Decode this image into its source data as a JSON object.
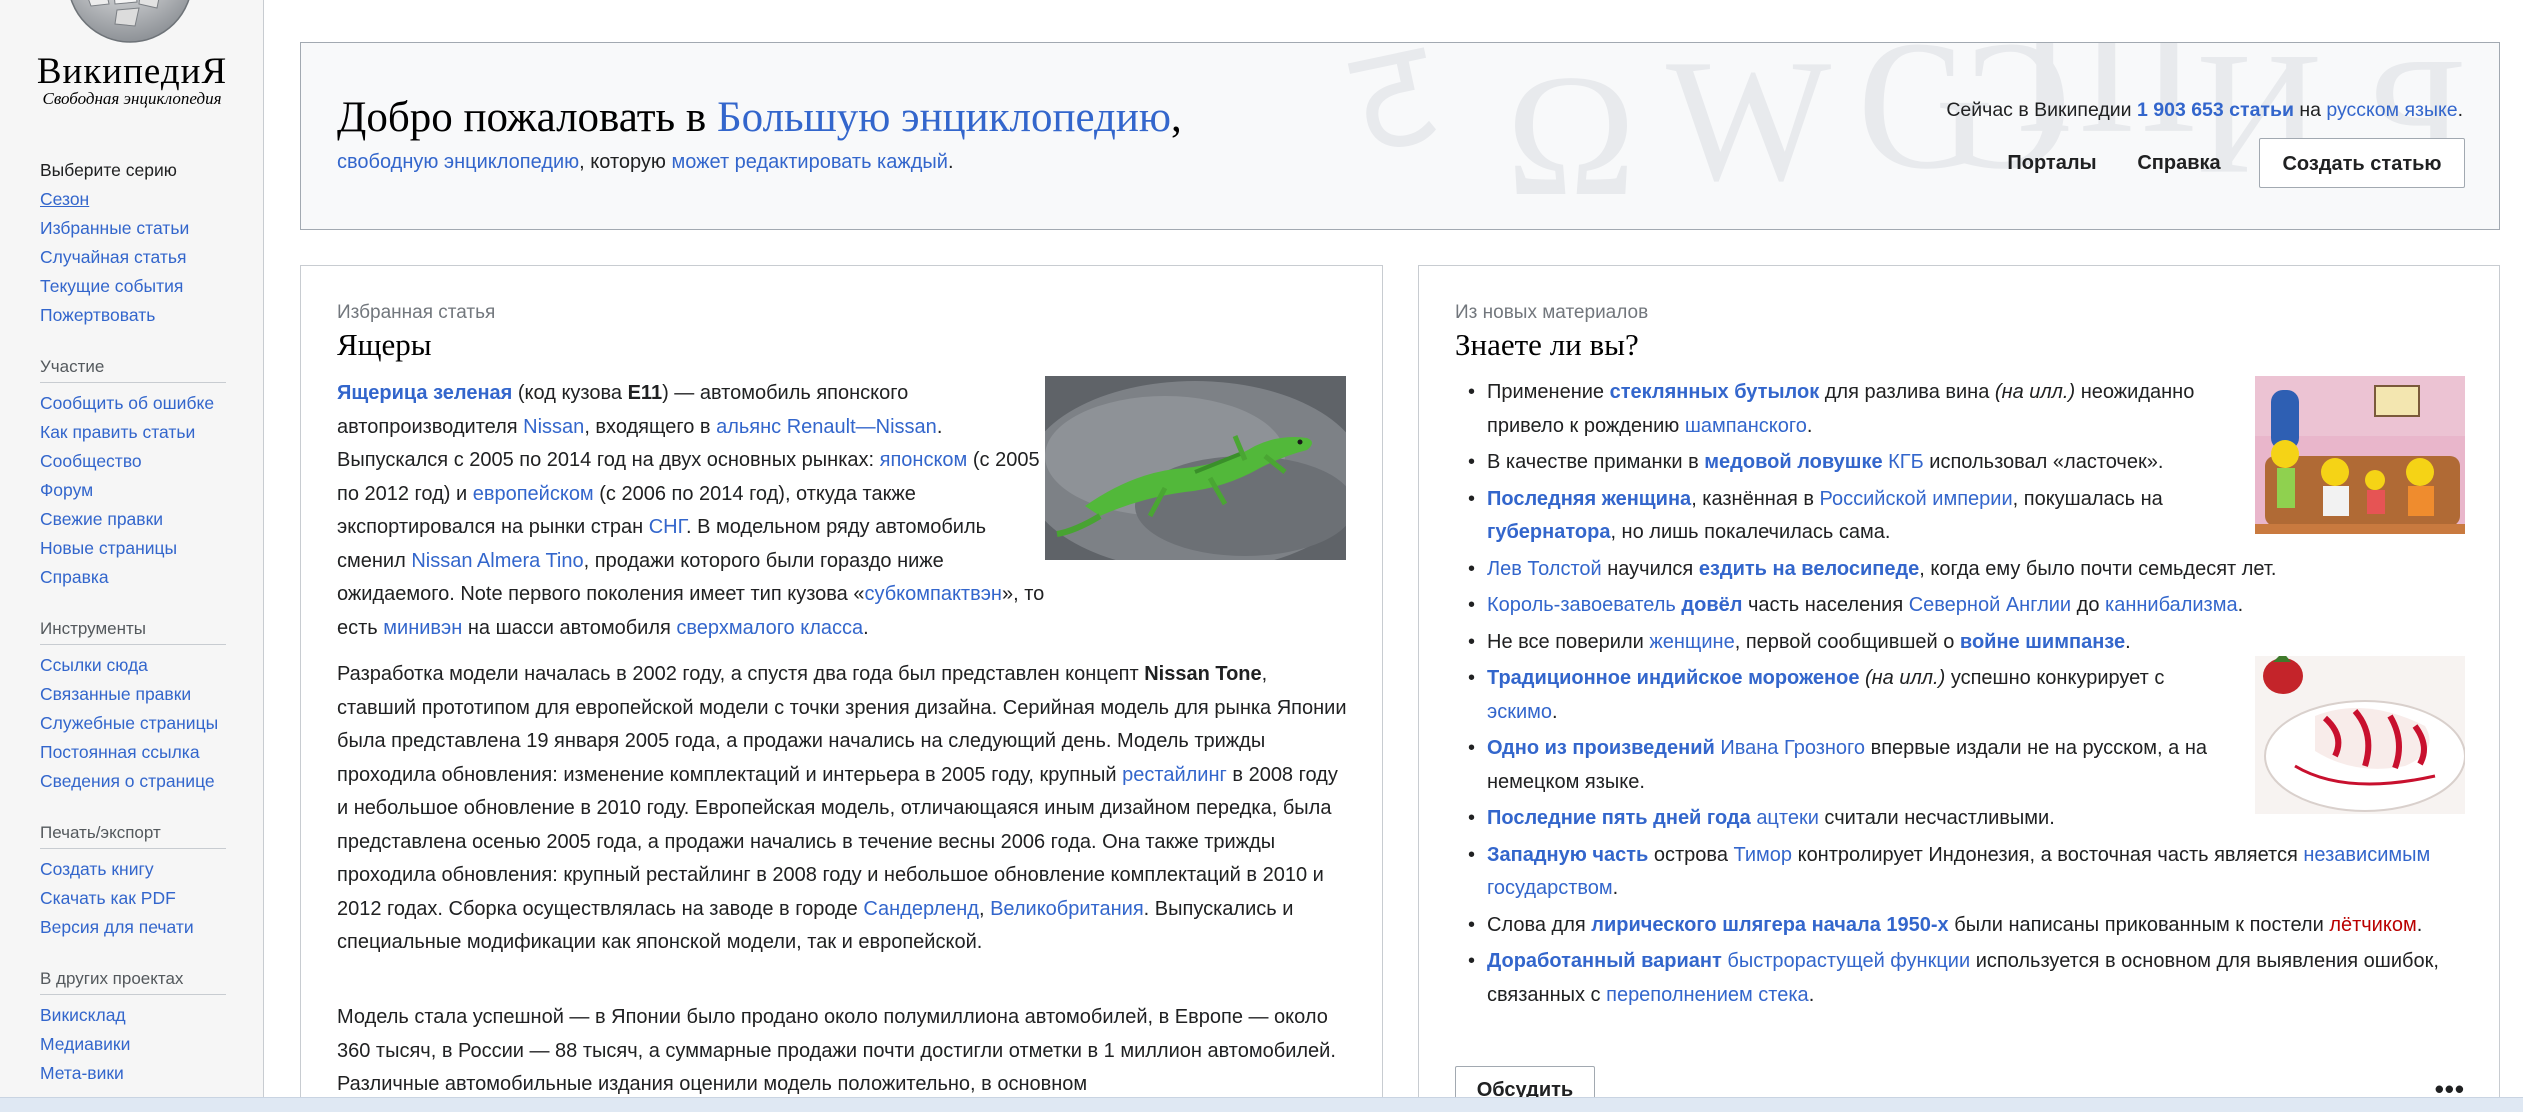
{
  "logo": {
    "wordmark": "ВикипедиЯ",
    "tagline": "Свободная энциклопедия"
  },
  "sidebar": {
    "main": [
      "Выберите серию",
      "Сезон",
      "Избранные статьи",
      "Случайная статья",
      "Текущие события",
      "Пожертвовать"
    ],
    "participation_heading": "Участие",
    "participation": [
      "Сообщить об ошибке",
      "Как править статьи",
      "Сообщество",
      "Форум",
      "Свежие правки",
      "Новые страницы",
      "Справка"
    ],
    "tools_heading": "Инструменты",
    "tools": [
      "Ссылки сюда",
      "Связанные правки",
      "Служебные страницы",
      "Постоянная ссылка",
      "Сведения о странице"
    ],
    "print_heading": "Печать/экспорт",
    "print": [
      "Создать книгу",
      "Скачать как PDF",
      "Версия для печати"
    ],
    "projects_heading": "В других проектах",
    "projects": [
      "Викисклад",
      "Медиавики",
      "Мета-вики"
    ]
  },
  "banner": {
    "title_prefix": "Добро пожаловать в ",
    "title_link": "Большую энциклопедию",
    "title_suffix": ",",
    "sub_link1": "свободную энциклопедию",
    "sub_mid": ", которую ",
    "sub_link2": "может редактировать каждый",
    "sub_end": ".",
    "count_prefix": "Сейчас в Википедии ",
    "count_link": "1 903 653 статьи",
    "count_mid": " на ",
    "count_lang": "русском языке",
    "count_end": ".",
    "btn_portals": "Порталы",
    "btn_help": "Справка",
    "btn_create": "Создать статью"
  },
  "featured": {
    "kicker": "Избранная статья",
    "title": "Ящеры",
    "p1": [
      {
        "t": "Ящерица зеленая",
        "c": "link bold"
      },
      {
        "t": " (код кузова "
      },
      {
        "t": "E11",
        "c": "bold"
      },
      {
        "t": ") — автомобиль японского автопроизводителя "
      },
      {
        "t": "Nissan",
        "c": "link"
      },
      {
        "t": ", входящего в "
      },
      {
        "t": "альянс Renault—Nissan",
        "c": "link"
      },
      {
        "t": ". Выпускался с 2005 по 2014 год на двух основных рынках: "
      },
      {
        "t": "японском",
        "c": "link"
      },
      {
        "t": " (с 2005 по 2012 год) и "
      },
      {
        "t": "европейском",
        "c": "link"
      },
      {
        "t": " (с 2006 по 2014 год), откуда также экспортировался на рынки стран "
      },
      {
        "t": "СНГ",
        "c": "link"
      },
      {
        "t": ". В модельном ряду автомобиль сменил "
      },
      {
        "t": "Nissan Almera Tino",
        "c": "link"
      },
      {
        "t": ", продажи которого были гораздо ниже ожидаемого. Note первого поколения имеет тип кузова «"
      },
      {
        "t": "субкомпактвэн",
        "c": "link"
      },
      {
        "t": "», то есть "
      },
      {
        "t": "минивэн",
        "c": "link"
      },
      {
        "t": " на шасси автомобиля "
      },
      {
        "t": "сверхмалого класса",
        "c": "link"
      },
      {
        "t": "."
      }
    ],
    "p2": [
      {
        "t": "Разработка модели началась в 2002 году, а спустя два года был представлен концепт "
      },
      {
        "t": "Nissan Tone",
        "c": "bold"
      },
      {
        "t": ", ставший прототипом для европейской модели с точки зрения дизайна. Серийная модель для рынка Японии была представлена 19 января 2005 года, а продажи начались на следующий день. Модель трижды проходила обновления: изменение комплектаций и интерьера в 2005 году, крупный "
      },
      {
        "t": "рестайлинг",
        "c": "link"
      },
      {
        "t": " в 2008 году и небольшое обновление в 2010 году. Европейская модель, отличающаяся иным дизайном передка, была представлена осенью 2005 года, а продажи начались в течение весны 2006 года. Она также трижды проходила обновления: крупный рестайлинг в 2008 году и небольшое обновление комплектаций в 2010 и 2012 годах. Сборка осуществлялась на заводе в городе "
      },
      {
        "t": "Сандерленд",
        "c": "link"
      },
      {
        "t": ", "
      },
      {
        "t": "Великобритания",
        "c": "link"
      },
      {
        "t": ". Выпускались и специальные модификации как японской модели, так и европейской."
      }
    ],
    "p3": [
      {
        "t": "Модель стала успешной — в Японии было продано около полумиллиона автомобилей, в Европе — около 360 тысяч, в России — 88 тысяч, а суммарные продажи почти достигли отметки в 1 миллион автомобилей. Различные автомобильные издания оценили модель положительно, в основном"
      }
    ]
  },
  "dyk": {
    "kicker": "Из новых материалов",
    "title": "Знаете ли вы?",
    "items": [
      [
        {
          "t": "Применение "
        },
        {
          "t": "стеклянных бутылок",
          "c": "link bold"
        },
        {
          "t": " для разлива вина "
        },
        {
          "t": "(на илл.)",
          "c": "ital"
        },
        {
          "t": " неожиданно привело к рождению "
        },
        {
          "t": "шампанского",
          "c": "link"
        },
        {
          "t": "."
        }
      ],
      [
        {
          "t": "В качестве приманки в "
        },
        {
          "t": "медовой ловушке",
          "c": "link bold"
        },
        {
          "t": " "
        },
        {
          "t": "КГБ",
          "c": "link"
        },
        {
          "t": " использовал «ласточек»."
        }
      ],
      [
        {
          "t": "Последняя женщина",
          "c": "link bold"
        },
        {
          "t": ", казнённая в "
        },
        {
          "t": "Российской империи",
          "c": "link"
        },
        {
          "t": ", покушалась на "
        },
        {
          "t": "губернатора",
          "c": "link bold"
        },
        {
          "t": ", но лишь покалечилась сама."
        }
      ],
      [
        {
          "t": "Лев Толстой",
          "c": "link"
        },
        {
          "t": " научился "
        },
        {
          "t": "ездить на велосипеде",
          "c": "link bold"
        },
        {
          "t": ", когда ему было почти семьдесят лет."
        }
      ],
      [
        {
          "t": "Король-завоеватель",
          "c": "link"
        },
        {
          "t": " "
        },
        {
          "t": "довёл",
          "c": "link bold"
        },
        {
          "t": " часть населения "
        },
        {
          "t": "Северной Англии",
          "c": "link"
        },
        {
          "t": " до "
        },
        {
          "t": "каннибализма",
          "c": "link"
        },
        {
          "t": "."
        }
      ],
      [
        {
          "t": "Не все поверили "
        },
        {
          "t": "женщине",
          "c": "link"
        },
        {
          "t": ", первой сообщившей о "
        },
        {
          "t": "войне шимпанзе",
          "c": "link bold"
        },
        {
          "t": "."
        }
      ],
      [
        {
          "t": "Традиционное индийское мороженое",
          "c": "link bold"
        },
        {
          "t": " "
        },
        {
          "t": "(на илл.)",
          "c": "ital"
        },
        {
          "t": " успешно конкурирует с "
        },
        {
          "t": "эскимо",
          "c": "link"
        },
        {
          "t": "."
        }
      ],
      [
        {
          "t": "Одно из произведений",
          "c": "link bold"
        },
        {
          "t": " "
        },
        {
          "t": "Ивана Грозного",
          "c": "link"
        },
        {
          "t": " впервые издали не на русском, а на немецком языке."
        }
      ],
      [
        {
          "t": "Последние пять дней года",
          "c": "link bold"
        },
        {
          "t": " "
        },
        {
          "t": "ацтеки",
          "c": "link"
        },
        {
          "t": " считали несчастливыми."
        }
      ],
      [
        {
          "t": "Западную часть",
          "c": "link bold"
        },
        {
          "t": " острова "
        },
        {
          "t": "Тимор",
          "c": "link"
        },
        {
          "t": " контролирует Индонезия, а восточная часть является "
        },
        {
          "t": "независимым государством",
          "c": "link"
        },
        {
          "t": "."
        }
      ],
      [
        {
          "t": "Слова для "
        },
        {
          "t": "лирического шлягера начала 1950-х",
          "c": "link bold"
        },
        {
          "t": " были написаны прикованным к постели "
        },
        {
          "t": "лётчиком",
          "c": "link-red"
        },
        {
          "t": "."
        }
      ],
      [
        {
          "t": "Доработанный вариант",
          "c": "link bold"
        },
        {
          "t": " "
        },
        {
          "t": "быстрорастущей функции",
          "c": "link"
        },
        {
          "t": " используется в основном для выявления ошибок, связанных с "
        },
        {
          "t": "переполнением стека",
          "c": "link"
        },
        {
          "t": "."
        }
      ]
    ],
    "discuss_btn": "Обсудить",
    "more": "•••"
  },
  "colors": {
    "link": "#3366cc",
    "redlink": "#ba0000",
    "text": "#202122",
    "sidebar_bg": "#f6f6f6",
    "banner_bg": "#f8f9fa",
    "border": "#a2a9b1"
  }
}
